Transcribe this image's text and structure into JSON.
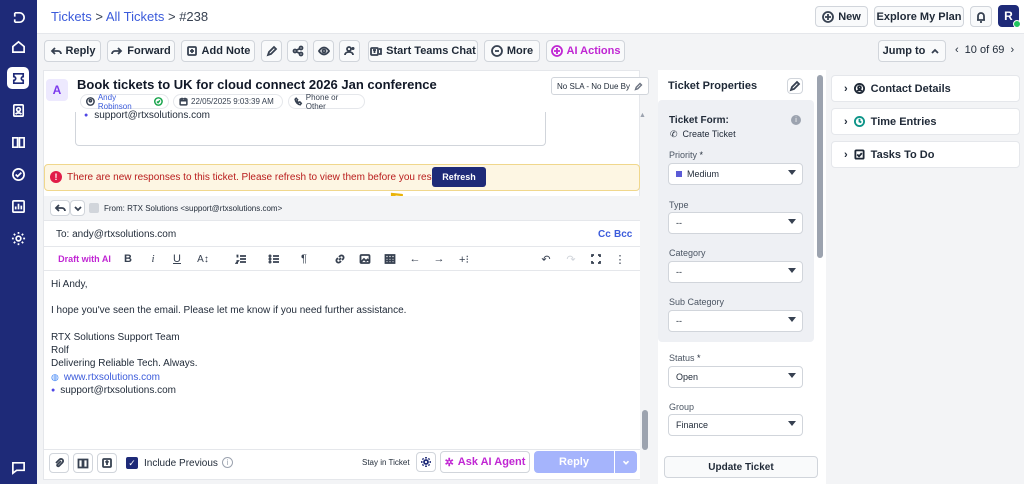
{
  "breadcrumb": {
    "tickets": "Tickets",
    "sep1": ">",
    "all_tickets": "All Tickets",
    "sep2": ">",
    "ticket_id": "#238"
  },
  "header": {
    "new_label": "New",
    "plan_label": "Explore My Plan",
    "avatar_initial": "R"
  },
  "toolbar": {
    "reply": "Reply",
    "forward": "Forward",
    "add_note": "Add Note",
    "teams_chat": "Start Teams Chat",
    "more": "More",
    "ai_actions": "AI Actions",
    "jump_to": "Jump to",
    "pager": "10 of 69"
  },
  "ticket": {
    "avatar": "A",
    "title": "Book tickets to UK for cloud connect 2026 Jan conference",
    "contact": "Andy Robinson",
    "date": "22/05/2025 9:03:39 AM",
    "source": "Phone or Other",
    "sla": "No SLA - No Due By",
    "quoted_email": "support@rtxsolutions.com"
  },
  "banner": {
    "message": "There are new responses to this ticket. Please refresh to view them before you respond.",
    "refresh": "Refresh"
  },
  "compose": {
    "from": "From:  RTX Solutions <support@rtxsolutions.com>",
    "to": "To: andy@rtxsolutions.com",
    "cc": "Cc",
    "bcc": "Bcc",
    "draft_ai": "Draft with AI",
    "body": [
      "Hi Andy,",
      "I hope you've seen the email. Please let me know if you need further assistance.",
      "RTX Solutions Support Team",
      "Rolf",
      "Delivering Reliable Tech. Always.",
      "www.rtxsolutions.com",
      "support@rtxsolutions.com"
    ],
    "include_previous": "Include Previous",
    "stay_in_ticket": "Stay in Ticket",
    "ask_ai_agent": "Ask AI Agent",
    "reply": "Reply"
  },
  "properties": {
    "heading": "Ticket Properties",
    "form_label": "Ticket Form:",
    "form_value": "Create Ticket",
    "priority_label": "Priority",
    "priority_value": "Medium",
    "type_label": "Type",
    "type_value": "--",
    "category_label": "Category",
    "category_value": "--",
    "subcategory_label": "Sub Category",
    "subcategory_value": "--",
    "status_label": "Status",
    "status_value": "Open",
    "group_label": "Group",
    "group_value": "Finance",
    "update": "Update Ticket",
    "required": "*"
  },
  "right_panel": {
    "contact": "Contact Details",
    "time": "Time Entries",
    "tasks": "Tasks To Do"
  },
  "colors": {
    "brand": "#1e2a78",
    "accent": "#3b5bdb",
    "ai": "#c026d3",
    "priority_dot": "#5b5bd6",
    "banner_bg": "#fdf6e3",
    "error": "#e11d48"
  }
}
